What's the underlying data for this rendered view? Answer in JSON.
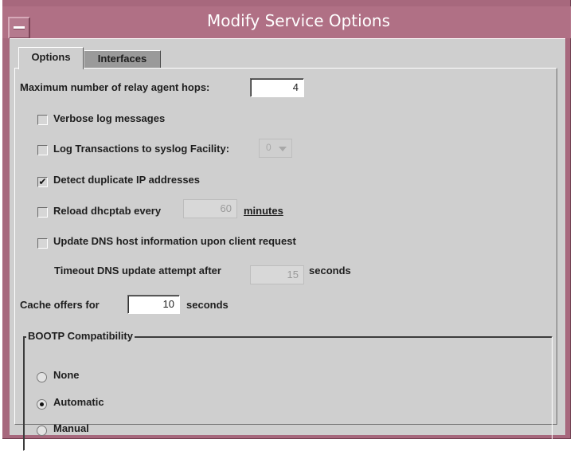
{
  "window": {
    "title": "Modify Service Options"
  },
  "tabs": [
    {
      "label": "Options",
      "active": true
    },
    {
      "label": "Interfaces",
      "active": false
    }
  ],
  "options": {
    "max_hops_label": "Maximum number of relay agent hops:",
    "max_hops_value": "4",
    "verbose_label": "Verbose log messages",
    "verbose_checked": false,
    "log_transactions_label": "Log Transactions to syslog Facility:",
    "log_transactions_checked": false,
    "syslog_facility_value": "0",
    "detect_duplicate_label": "Detect duplicate IP addresses",
    "detect_duplicate_checked": true,
    "reload_label": "Reload dhcptab every",
    "reload_checked": false,
    "reload_value": "60",
    "reload_unit": "minutes",
    "update_dns_label": "Update DNS host information upon client request",
    "update_dns_checked": false,
    "timeout_label": "Timeout DNS update attempt after",
    "timeout_value": "15",
    "timeout_unit": "seconds",
    "cache_label": "Cache offers for",
    "cache_value": "10",
    "cache_unit": "seconds"
  },
  "bootp": {
    "legend": "BOOTP Compatibility",
    "options": [
      {
        "label": "None",
        "selected": false
      },
      {
        "label": "Automatic",
        "selected": true
      },
      {
        "label": "Manual",
        "selected": false
      }
    ]
  },
  "colors": {
    "titlebar": "#b07085",
    "window_frame": "#a7687d",
    "panel_bg": "#cfcfcf"
  }
}
